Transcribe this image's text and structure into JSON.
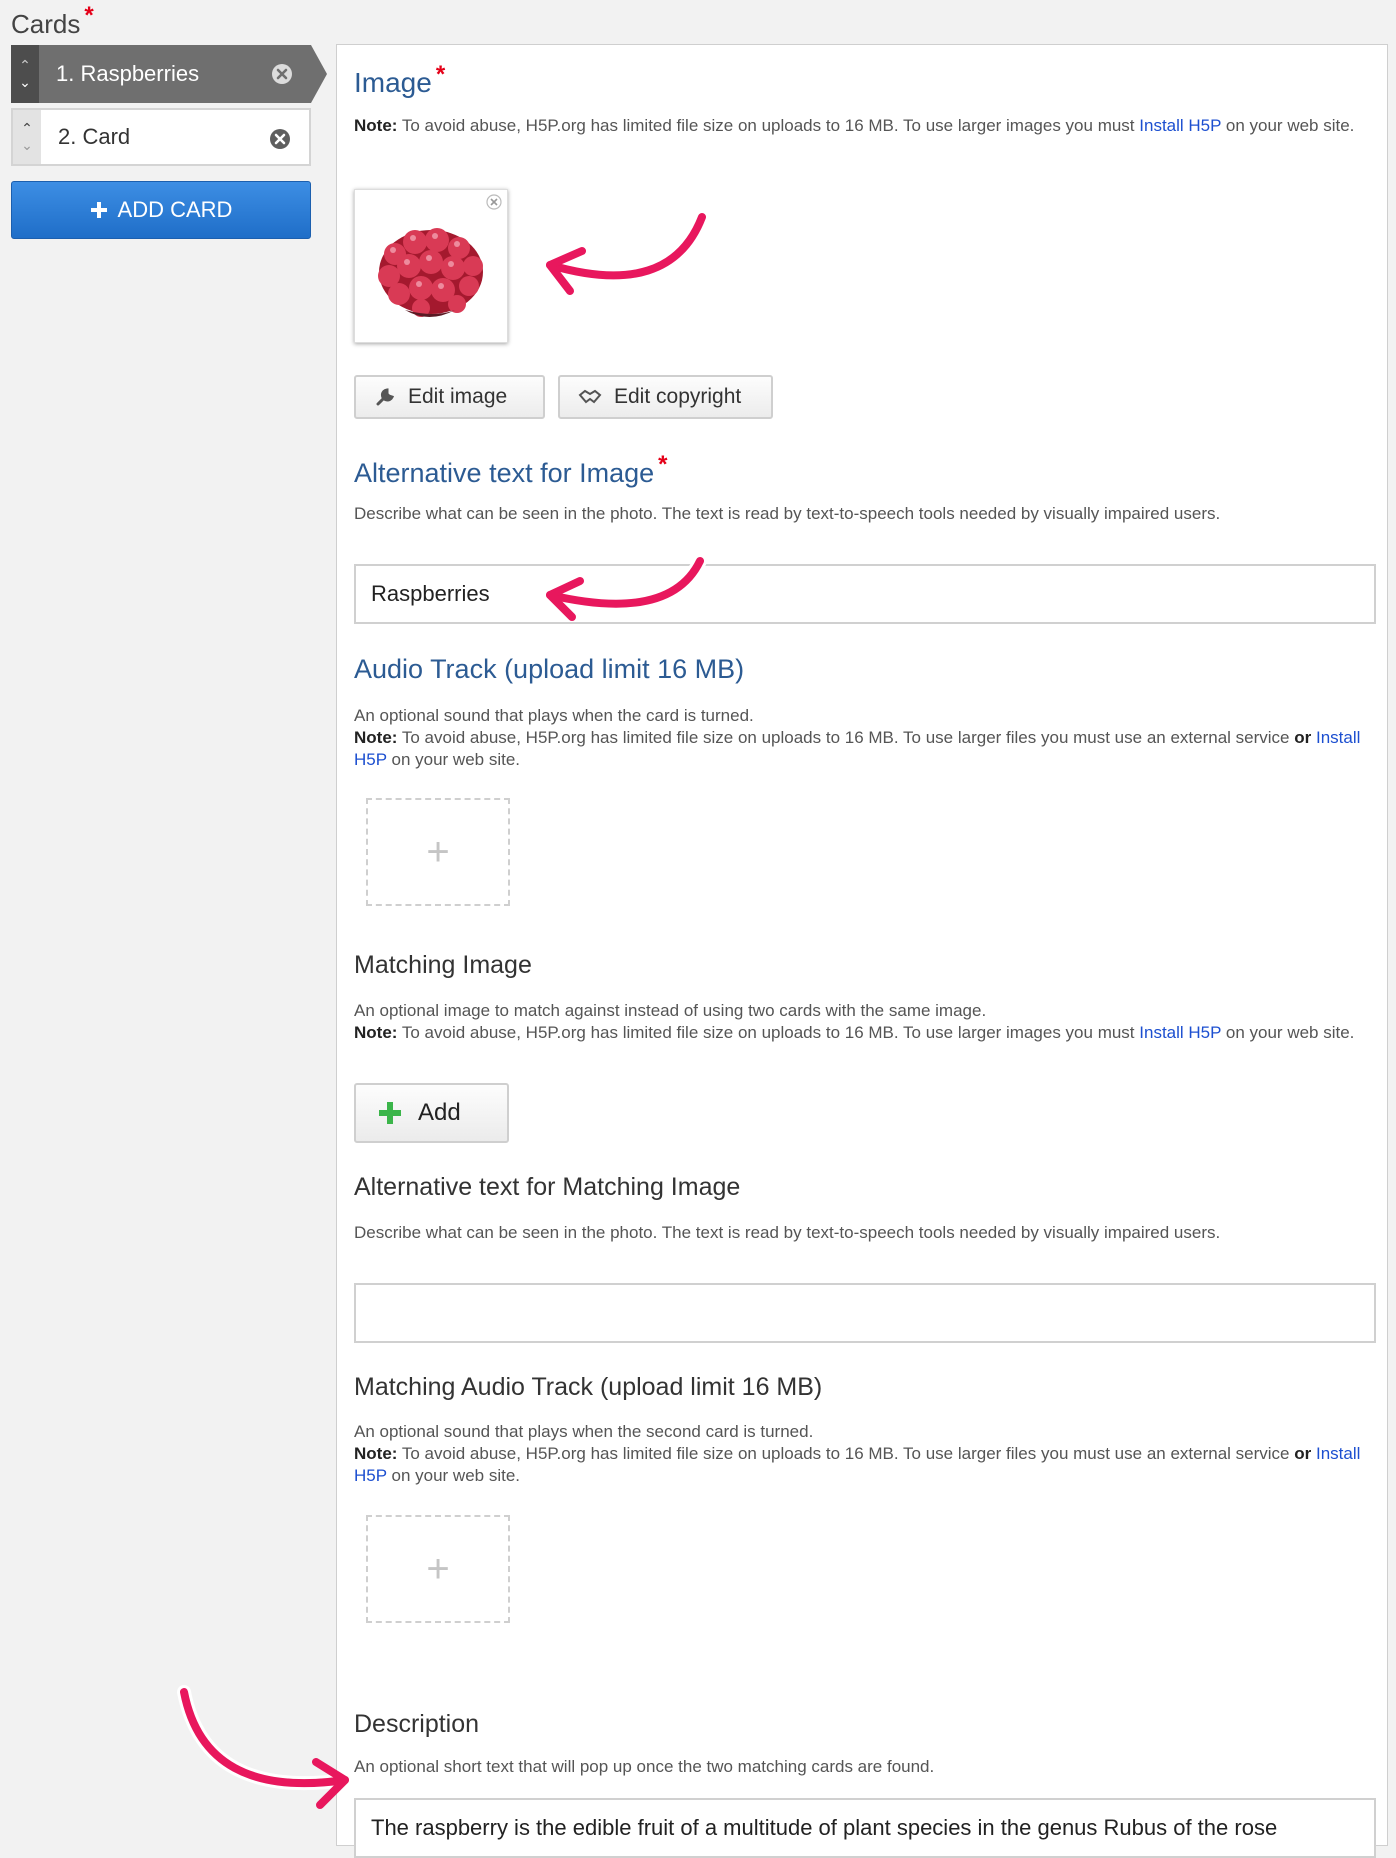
{
  "cards_header": {
    "title": "Cards",
    "required_mark": "*"
  },
  "card_list": [
    {
      "label": "1. Raspberries",
      "active": true
    },
    {
      "label": "2. Card",
      "active": false
    }
  ],
  "add_card_label": "ADD CARD",
  "panel": {
    "image": {
      "title": "Image",
      "required_mark": "*",
      "note_label": "Note:",
      "note_text_1": " To avoid abuse, H5P.org has limited file size on uploads to 16 MB. To use larger images you must ",
      "note_link": "Install H5P",
      "note_text_2": " on your web site.",
      "edit_image_label": "Edit image",
      "edit_copyright_label": "Edit copyright"
    },
    "alt_text": {
      "title": "Alternative text for Image",
      "required_mark": "*",
      "description": "Describe what can be seen in the photo. The text is read by text-to-speech tools needed by visually impaired users.",
      "value": "Raspberries"
    },
    "audio": {
      "title": "Audio Track (upload limit 16 MB)",
      "line1": "An optional sound that plays when the card is turned.",
      "note_label": "Note:",
      "note_text_1": " To avoid abuse, H5P.org has limited file size on uploads to 16 MB. To use larger files you must use an external service ",
      "or_label": "or",
      "note_link": "Install H5P",
      "note_text_2": " on your web site.",
      "plus": "+"
    },
    "matching_image": {
      "title": "Matching Image",
      "line1": "An optional image to match against instead of using two cards with the same image.",
      "note_label": "Note:",
      "note_text_1": " To avoid abuse, H5P.org has limited file size on uploads to 16 MB. To use larger images you must ",
      "note_link": "Install H5P",
      "note_text_2": " on your web site.",
      "add_label": "Add"
    },
    "matching_alt": {
      "title": "Alternative text for Matching Image",
      "description": "Describe what can be seen in the photo. The text is read by text-to-speech tools needed by visually impaired users.",
      "value": ""
    },
    "matching_audio": {
      "title": "Matching Audio Track (upload limit 16 MB)",
      "line1": "An optional sound that plays when the second card is turned.",
      "note_label": "Note:",
      "note_text_1": " To avoid abuse, H5P.org has limited file size on uploads to 16 MB. To use larger files you must use an external service ",
      "or_label": "or",
      "note_link": "Install H5P",
      "note_text_2": " on your web site.",
      "plus": "+"
    },
    "description": {
      "title": "Description",
      "help": "An optional short text that will pop up once the two matching cards are found.",
      "value": "The raspberry is the edible fruit of a multitude of plant species in the genus Rubus of the rose"
    }
  },
  "colors": {
    "accent_blue": "#2c5b93",
    "required_red": "#e40018",
    "arrow_pink": "#e8175d",
    "add_card_blue": "#2a7bd6"
  }
}
